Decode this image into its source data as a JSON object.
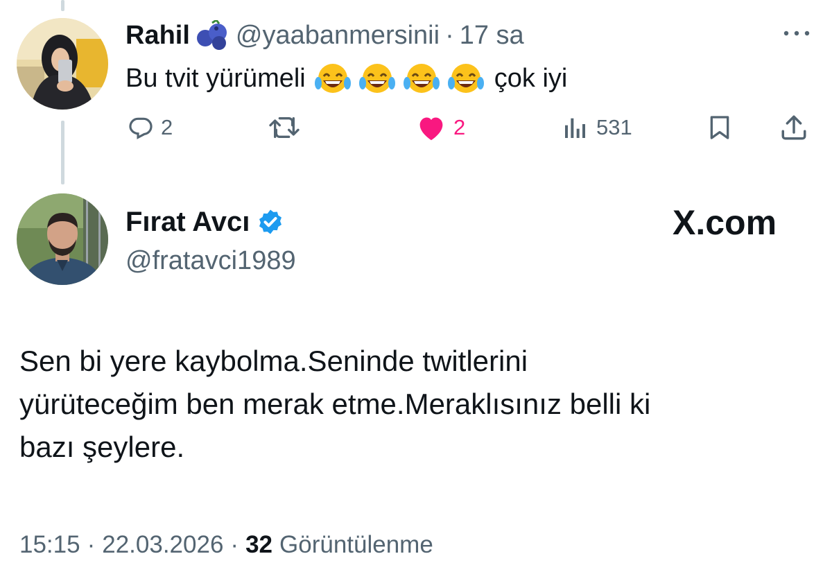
{
  "reply": {
    "author_name": "Rahil",
    "author_handle": "@yaabanmersinii",
    "separator": "·",
    "time": "17 sa",
    "text_before": "Bu tvit yürümeli",
    "emoji": [
      "joy-emoji",
      "joy-emoji",
      "joy-emoji",
      "joy-emoji"
    ],
    "text_after": "çok iyi",
    "name_decoration": "blueberries-emoji",
    "actions": {
      "reply_count": "2",
      "retweet_count": "",
      "like_count": "2",
      "views_count": "531"
    },
    "icons": [
      "reply-icon",
      "retweet-icon",
      "heart-icon",
      "views-icon",
      "bookmark-icon",
      "share-icon",
      "more-icon"
    ]
  },
  "tweet": {
    "author_name": "Fırat Avcı",
    "author_handle": "@fratavci1989",
    "verified": true,
    "brand": "X.com",
    "text_lines": [
      "Sen bi yere kaybolma.Seninde twitlerini",
      "yürüteceğim ben merak etme.Meraklısınız belli ki",
      "bazı şeylere."
    ],
    "time": "15:15",
    "date": "22.03.2026",
    "separator": "·",
    "views_count": "32",
    "views_label": "Görüntülenme"
  },
  "colors": {
    "text_primary": "#0f1419",
    "text_secondary": "#536471",
    "like_pink": "#f91880",
    "verified_blue": "#1d9bf0",
    "thread_line": "#cfd9de"
  }
}
